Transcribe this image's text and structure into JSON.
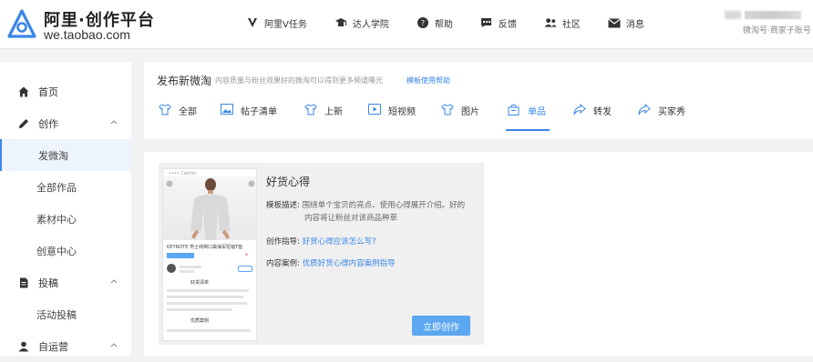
{
  "brand": {
    "title": "阿里·创作平台",
    "subtitle": "we.taobao.com",
    "accent": "#3a86e8"
  },
  "topnav": [
    {
      "icon": "v-icon",
      "label": "阿里V任务"
    },
    {
      "icon": "graduation-cap-icon",
      "label": "达人学院"
    },
    {
      "icon": "help-icon",
      "label": "帮助"
    },
    {
      "icon": "feedback-icon",
      "label": "反馈"
    },
    {
      "icon": "community-icon",
      "label": "社区"
    },
    {
      "icon": "mail-icon",
      "label": "消息"
    }
  ],
  "user": {
    "sub": "微淘号·商家子账号"
  },
  "sidebar": {
    "items": [
      {
        "label": "首页",
        "icon": "home-icon",
        "type": "main"
      },
      {
        "label": "创作",
        "icon": "pen-icon",
        "type": "main",
        "caret": "up"
      },
      {
        "label": "发微淘",
        "type": "sub",
        "active": true
      },
      {
        "label": "全部作品",
        "type": "sub"
      },
      {
        "label": "素材中心",
        "type": "sub"
      },
      {
        "label": "创意中心",
        "type": "sub"
      },
      {
        "label": "投稿",
        "icon": "document-icon",
        "type": "main",
        "caret": "up"
      },
      {
        "label": "活动投稿",
        "type": "sub"
      },
      {
        "label": "自运营",
        "icon": "user-icon",
        "type": "main",
        "caret": "up"
      }
    ]
  },
  "header": {
    "title": "发布新微淘",
    "desc": "内容质量与粉丝效果好的微淘可以得到更多频道曝光",
    "link": "模板使用帮助"
  },
  "tabs": [
    {
      "label": "全部",
      "icon": "shirt-icon"
    },
    {
      "label": "帖子清单",
      "icon": "image-icon"
    },
    {
      "label": "上新",
      "icon": "shirt-icon"
    },
    {
      "label": "短视频",
      "icon": "video-icon"
    },
    {
      "label": "图片",
      "icon": "shirt-icon"
    },
    {
      "label": "单品",
      "icon": "bag-icon",
      "active": true
    },
    {
      "label": "转发",
      "icon": "share-icon"
    },
    {
      "label": "买家秀",
      "icon": "share-icon"
    }
  ],
  "card": {
    "title": "好货心得",
    "desc_key": "模板描述:",
    "desc_line1": "围绕单个宝贝的亮点、使用心得展开介绍。好的",
    "desc_line2": "内容将让粉丝对该商品种草",
    "guide_key": "创作指导:",
    "guide_link": "好货心得应该怎么写?",
    "case_key": "内容案例:",
    "case_link": "优质好货心得内容案例指导",
    "button": "立即创作",
    "phone": {
      "status": "•••• Carrier",
      "caption": "KEYNOTE 男士纯棉口袋海军短袖T恤",
      "sec1": "好货清单",
      "sec2": "优质案例"
    }
  }
}
